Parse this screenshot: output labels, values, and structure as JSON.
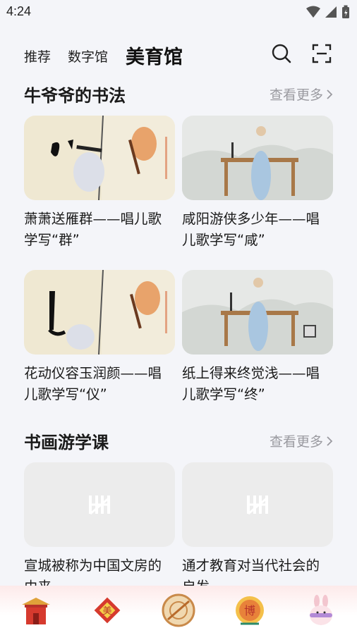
{
  "status": {
    "time": "4:24"
  },
  "nav": {
    "tabs": [
      "推荐",
      "数字馆",
      "美育馆"
    ],
    "active_index": 2
  },
  "sections": [
    {
      "title": "牛爷爷的书法",
      "more": "查看更多",
      "cards": [
        {
          "title": "萧萧送雁群——唱儿歌学写“群”"
        },
        {
          "title": "咸阳游侠多少年——唱儿歌学写“咸”"
        },
        {
          "title": "花动仪容玉润颜——唱儿歌学写“仪”"
        },
        {
          "title": "纸上得来终觉浅——唱儿歌学写“终”"
        }
      ]
    },
    {
      "title": "书画游学课",
      "more": "查看更多",
      "cards": [
        {
          "title": "宣城被称为中国文房的由来"
        },
        {
          "title": "通才教育对当代社会的启发"
        }
      ]
    }
  ],
  "colors": {
    "background": "#f4f5f9",
    "more": "#9a9aa0",
    "bottom_bar_tint": "#fdeaea"
  }
}
